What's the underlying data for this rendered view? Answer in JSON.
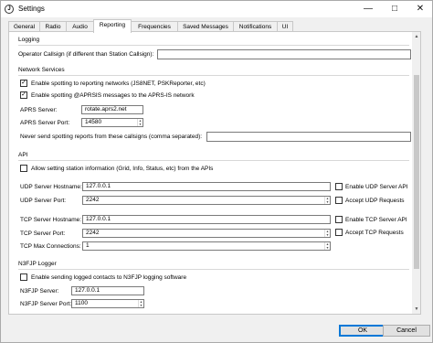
{
  "window": {
    "title": "Settings",
    "app_icon": "disc-icon"
  },
  "tabs": [
    "General",
    "Radio",
    "Audio",
    "Reporting",
    "Frequencies",
    "Saved Messages",
    "Notifications",
    "UI"
  ],
  "active_tab": "Reporting",
  "logging": {
    "title": "Logging",
    "operator_label": "Operator Callsign (if different than Station Callsign):",
    "operator_value": ""
  },
  "network": {
    "title": "Network Services",
    "enable_spotting_label": "Enable spotting to reporting networks (JS8NET, PSKReporter, etc)",
    "enable_spotting_checked": true,
    "enable_aprsis_label": "Enable spotting @APRSIS messages to the APRS-IS network",
    "enable_aprsis_checked": true,
    "aprs_server_label": "APRS Server:",
    "aprs_server_value": "rotate.aprs2.net",
    "aprs_port_label": "APRS Server Port:",
    "aprs_port_value": "14580",
    "never_spot_label": "Never send spotting reports from these callsigns (comma separated):",
    "never_spot_value": ""
  },
  "api": {
    "title": "API",
    "allow_label": "Allow setting station information (Grid, Info, Status, etc) from the APIs",
    "allow_checked": false,
    "udp_host_label": "UDP Server Hostname:",
    "udp_host_value": "127.0.0.1",
    "udp_enable_label": "Enable UDP Server API",
    "udp_enable_checked": false,
    "udp_port_label": "UDP Server Port:",
    "udp_port_value": "2242",
    "udp_accept_label": "Accept UDP Requests",
    "udp_accept_checked": false,
    "tcp_host_label": "TCP Server Hostname:",
    "tcp_host_value": "127.0.0.1",
    "tcp_enable_label": "Enable TCP Server API",
    "tcp_enable_checked": false,
    "tcp_port_label": "TCP Server Port:",
    "tcp_port_value": "2242",
    "tcp_accept_label": "Accept TCP Requests",
    "tcp_accept_checked": false,
    "tcp_max_label": "TCP Max Connections:",
    "tcp_max_value": "1"
  },
  "n3fjp": {
    "title": "N3FJP Logger",
    "enable_label": "Enable sending logged contacts to N3FJP logging software",
    "enable_checked": false,
    "server_label": "N3FJP Server:",
    "server_value": "127.0.0.1",
    "port_label": "N3FJP Server Port:",
    "port_value": "1100"
  },
  "buttons": {
    "ok": "OK",
    "cancel": "Cancel"
  }
}
